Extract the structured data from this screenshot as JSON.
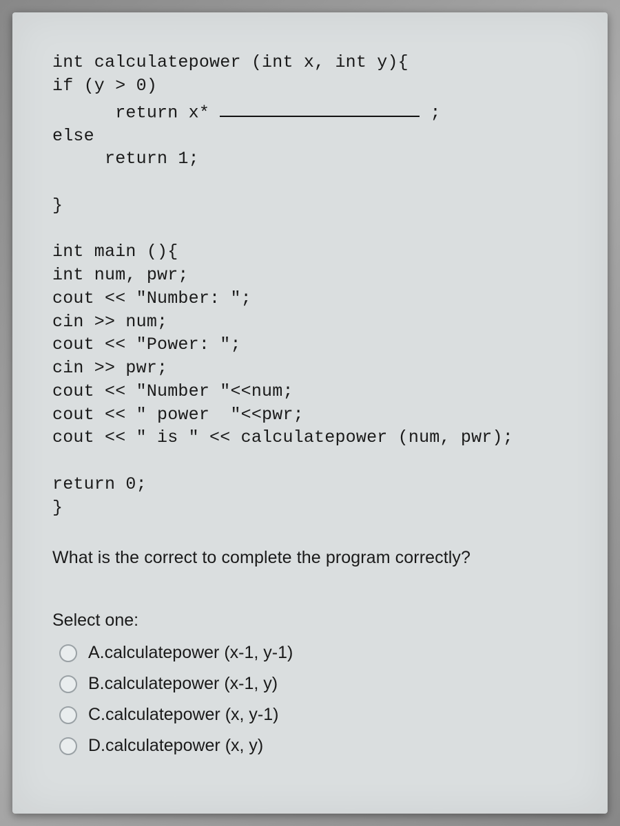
{
  "code": {
    "l1": "int calculatepower (int x, int y){",
    "l2": "if (y > 0)",
    "l3a": "      return x* ",
    "l3b": " ;",
    "l4": "else",
    "l5": "     return 1;",
    "l6": "",
    "l7": "}",
    "l8": "",
    "l9": "int main (){",
    "l10": "int num, pwr;",
    "l11": "cout << \"Number: \";",
    "l12": "cin >> num;",
    "l13": "cout << \"Power: \";",
    "l14": "cin >> pwr;",
    "l15": "cout << \"Number \"<<num;",
    "l16": "cout << \" power  \"<<pwr;",
    "l17": "cout << \" is \" << calculatepower (num, pwr);",
    "l18": "",
    "l19": "return 0;",
    "l20": "}"
  },
  "question": "What is the correct to complete the program correctly?",
  "select_label": "Select one:",
  "options": [
    "A.calculatepower (x-1, y-1)",
    "B.calculatepower (x-1, y)",
    "C.calculatepower (x, y-1)",
    "D.calculatepower (x, y)"
  ]
}
